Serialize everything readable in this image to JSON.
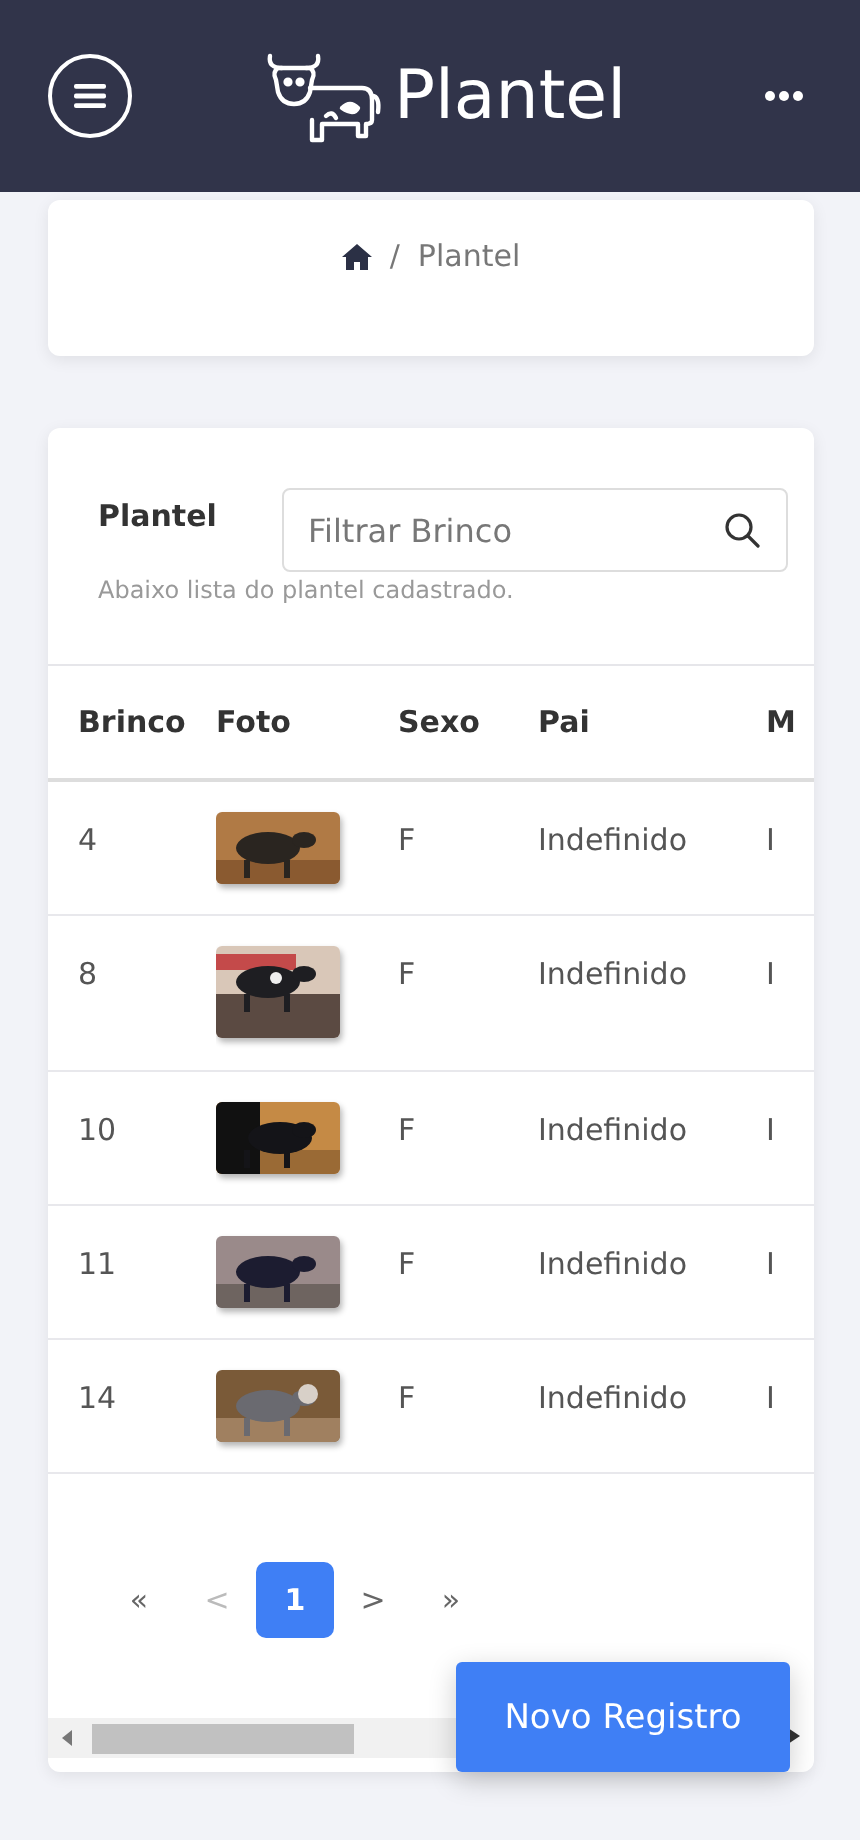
{
  "header": {
    "title": "Plantel"
  },
  "breadcrumb": {
    "separator": "/",
    "items": [
      "Plantel"
    ]
  },
  "list": {
    "title": "Plantel",
    "subtitle": "Abaixo lista do plantel cadastrado.",
    "search": {
      "placeholder": "Filtrar Brinco"
    },
    "columns": [
      "Brinco",
      "Foto",
      "Sexo",
      "Pai",
      "M"
    ],
    "rows": [
      {
        "brinco": "4",
        "sexo": "F",
        "pai": "Indefinido",
        "column_5": "I"
      },
      {
        "brinco": "8",
        "sexo": "F",
        "pai": "Indefinido",
        "column_5": "I"
      },
      {
        "brinco": "10",
        "sexo": "F",
        "pai": "Indefinido",
        "column_5": "I"
      },
      {
        "brinco": "11",
        "sexo": "F",
        "pai": "Indefinido",
        "column_5": "I"
      },
      {
        "brinco": "14",
        "sexo": "F",
        "pai": "Indefinido",
        "column_5": "I"
      }
    ],
    "pagination": [
      {
        "label": "«",
        "selected": false,
        "disabled": false
      },
      {
        "label": "<",
        "selected": false,
        "disabled": true
      },
      {
        "label": "1",
        "selected": true,
        "disabled": false
      },
      {
        "label": ">",
        "selected": false,
        "disabled": false
      },
      {
        "label": "»",
        "selected": false,
        "disabled": false
      }
    ]
  },
  "fab": {
    "label": "Novo Registro"
  }
}
